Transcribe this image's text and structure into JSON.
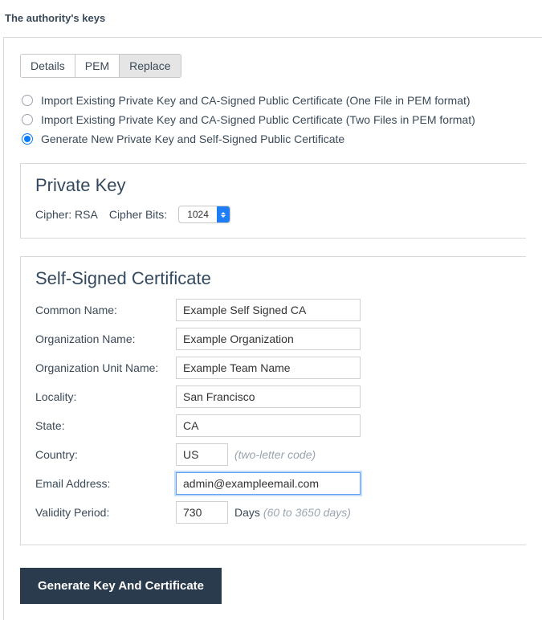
{
  "section_title": "The authority's keys",
  "tabs": {
    "details": "Details",
    "pem": "PEM",
    "replace": "Replace"
  },
  "radios": {
    "opt1": "Import Existing Private Key and CA-Signed Public Certificate (One File in PEM format)",
    "opt2": "Import Existing Private Key and CA-Signed Public Certificate (Two Files in PEM format)",
    "opt3": "Generate New Private Key and Self-Signed Public Certificate"
  },
  "private_key": {
    "title": "Private Key",
    "cipher_label": "Cipher:",
    "cipher_value": "RSA",
    "bits_label": "Cipher Bits:",
    "bits_value": "1024"
  },
  "cert": {
    "title": "Self-Signed Certificate",
    "labels": {
      "common_name": "Common Name:",
      "org_name": "Organization Name:",
      "org_unit": "Organization Unit Name:",
      "locality": "Locality:",
      "state": "State:",
      "country": "Country:",
      "email": "Email Address:",
      "validity": "Validity Period:"
    },
    "values": {
      "common_name": "Example Self Signed CA",
      "org_name": "Example Organization",
      "org_unit": "Example Team Name",
      "locality": "San Francisco",
      "state": "CA",
      "country": "US",
      "email": "admin@exampleemail.com",
      "validity": "730"
    },
    "hints": {
      "country": "(two-letter code)",
      "validity_prefix": "Days",
      "validity": "(60 to 3650 days)"
    }
  },
  "submit_label": "Generate Key And Certificate"
}
